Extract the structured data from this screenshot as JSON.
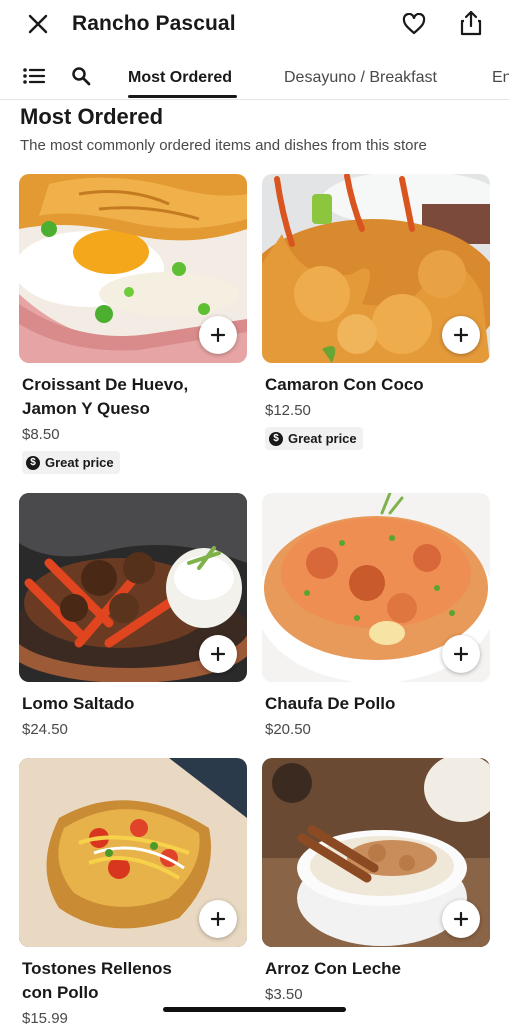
{
  "header": {
    "store_name": "Rancho Pascual",
    "icons": {
      "close": "close-icon",
      "favorite": "heart-icon",
      "share": "share-icon"
    }
  },
  "tabbar": {
    "icons": {
      "menu": "list-icon",
      "search": "search-icon"
    },
    "tabs": [
      {
        "label": "Most Ordered",
        "active": true
      },
      {
        "label": "Desayuno / Breakfast",
        "active": false
      },
      {
        "label": "En",
        "active": false
      }
    ]
  },
  "section": {
    "title": "Most Ordered",
    "subtitle": "The most commonly ordered items and dishes from this store"
  },
  "items": [
    {
      "name_line1": "Croissant De Huevo,",
      "name_line2": "Jamon Y Queso",
      "price": "$8.50",
      "badge": "Great price"
    },
    {
      "name_line1": "Camaron Con Coco",
      "name_line2": "",
      "price": "$12.50",
      "badge": "Great price"
    },
    {
      "name_line1": "Lomo Saltado",
      "name_line2": "",
      "price": "$24.50",
      "badge": ""
    },
    {
      "name_line1": "Chaufa De Pollo",
      "name_line2": "",
      "price": "$20.50",
      "badge": ""
    },
    {
      "name_line1": "Tostones Rellenos",
      "name_line2": "con Pollo",
      "price": "$15.99",
      "badge": ""
    },
    {
      "name_line1": "Arroz Con Leche",
      "name_line2": "",
      "price": "$3.50",
      "badge": ""
    }
  ],
  "badge_symbol": "$",
  "colors": {
    "text": "#191919",
    "secondary": "#494949",
    "badge_bg": "#f1f1f1",
    "accent": "#191919"
  }
}
